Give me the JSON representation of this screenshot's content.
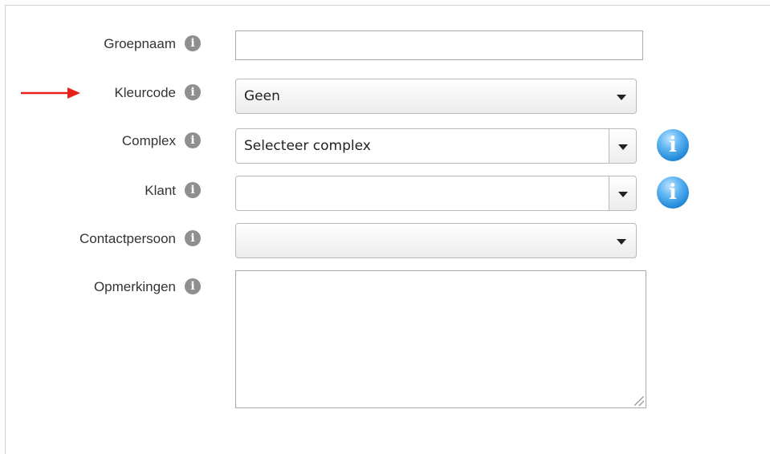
{
  "form": {
    "groepnaam": {
      "label": "Groepnaam",
      "value": ""
    },
    "kleurcode": {
      "label": "Kleurcode",
      "selected": "Geen"
    },
    "complex": {
      "label": "Complex",
      "selected": "Selecteer complex"
    },
    "klant": {
      "label": "Klant",
      "selected": ""
    },
    "contactpersoon": {
      "label": "Contactpersoon",
      "selected": ""
    },
    "opmerkingen": {
      "label": "Opmerkingen",
      "value": ""
    }
  },
  "icons": {
    "help": "info-circle-grey-icon",
    "info": "info-circle-blue-icon",
    "arrow": "red-arrow-right-icon",
    "help_glyph": "i",
    "info_glyph": "i"
  },
  "colors": {
    "arrow": "#e8201a",
    "info_blue": "#1f86d6",
    "help_grey": "#8f8f8f"
  }
}
